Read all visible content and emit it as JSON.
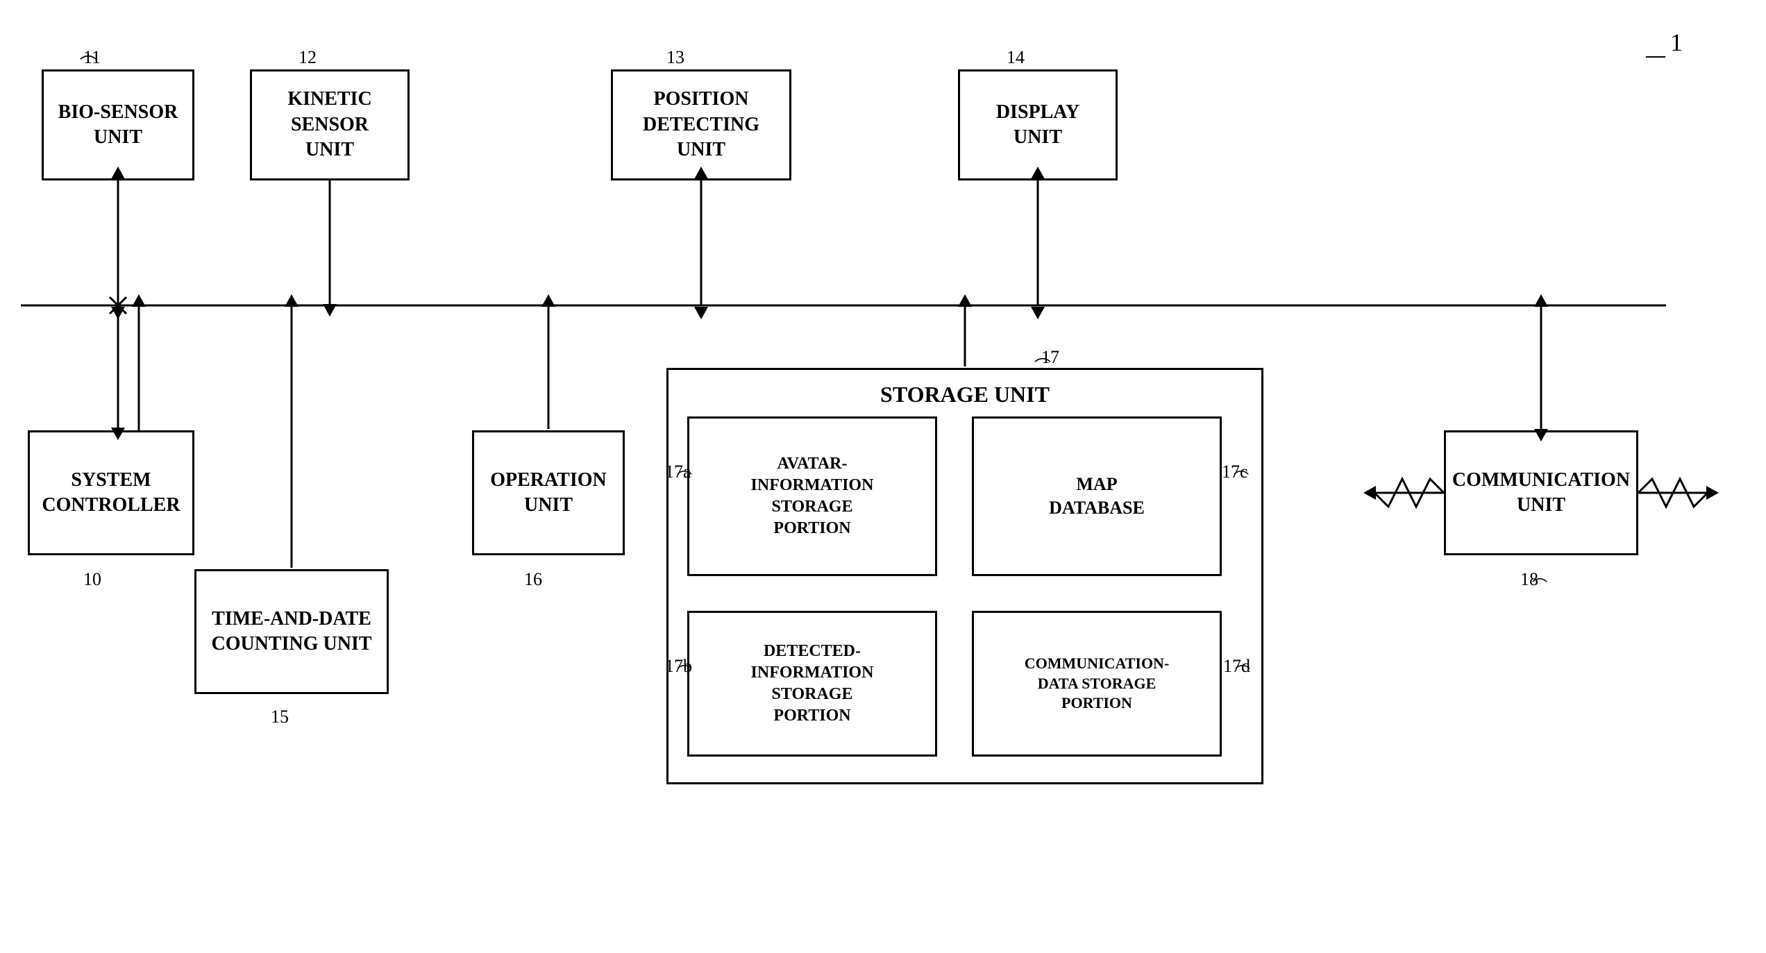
{
  "diagram": {
    "title_ref": "1",
    "boxes": {
      "bio_sensor": {
        "label": "BIO-SENSOR\nUNIT",
        "ref": "11"
      },
      "kinetic_sensor": {
        "label": "KINETIC\nSENSOR\nUNIT",
        "ref": "12"
      },
      "position_detecting": {
        "label": "POSITION\nDETECTING\nUNIT",
        "ref": "13"
      },
      "display": {
        "label": "DISPLAY\nUNIT",
        "ref": "14"
      },
      "system_controller": {
        "label": "SYSTEM\nCONTROLLER",
        "ref": "10"
      },
      "time_date": {
        "label": "TIME-AND-DATE\nCOUNTING UNIT",
        "ref": "15"
      },
      "operation": {
        "label": "OPERATION\nUNIT",
        "ref": "16"
      },
      "storage": {
        "label": "STORAGE UNIT",
        "ref": "17"
      },
      "avatar_storage": {
        "label": "AVATAR-\nINFORMATION\nSTORAGE\nPORTION",
        "ref": "17a"
      },
      "map_database": {
        "label": "MAP\nDATABASE",
        "ref": "17c"
      },
      "detected_storage": {
        "label": "DETECTED-\nINFORMATION\nSTORAGE\nPORTION",
        "ref": "17b"
      },
      "comm_data_storage": {
        "label": "COMMUNICATION-\nDATA STORAGE\nPORTION",
        "ref": "17d"
      },
      "communication": {
        "label": "COMMUNICATION\nUNIT",
        "ref": "18"
      }
    }
  }
}
